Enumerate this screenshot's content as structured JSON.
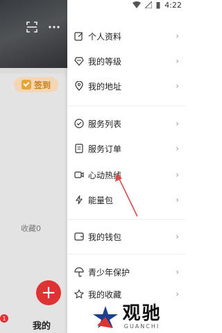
{
  "status_bar": {
    "time": "4:22"
  },
  "background": {
    "checkin_label": "签到",
    "collect_label": "收藏0",
    "fab_symbol": "+",
    "badge_count": "1",
    "tab_label": "我的"
  },
  "drawer": {
    "items": [
      {
        "label": "个人资料",
        "icon": "edit-icon"
      },
      {
        "label": "我的等级",
        "icon": "diamond-icon"
      },
      {
        "label": "我的地址",
        "icon": "location-icon"
      },
      {
        "label": "服务列表",
        "icon": "check-circle-icon"
      },
      {
        "label": "服务订单",
        "icon": "document-icon"
      },
      {
        "label": "心动热线",
        "icon": "video-icon"
      },
      {
        "label": "能量包",
        "icon": "lightning-icon"
      },
      {
        "label": "我的钱包",
        "icon": "wallet-icon"
      },
      {
        "label": "青少年保护",
        "icon": "umbrella-icon"
      },
      {
        "label": "我的收藏",
        "icon": "star-icon"
      }
    ],
    "chevron": "›"
  },
  "watermark": {
    "title": "观驰",
    "subtitle": "GUANCHI"
  },
  "colors": {
    "accent": "#d33333",
    "checkin_bg": "#f3d7b4",
    "checkin_text": "#c9801a"
  }
}
